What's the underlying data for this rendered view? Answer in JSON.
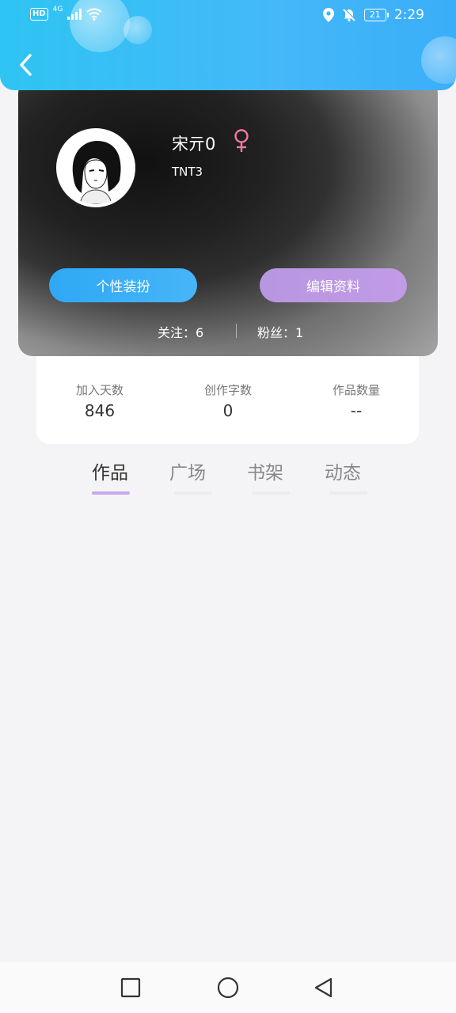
{
  "status_bar": {
    "hd": "HD",
    "network": "4G",
    "battery": "21",
    "time": "2:29"
  },
  "profile": {
    "username": "宋亓0",
    "user_id": "TNT3",
    "gender": "female",
    "dress_button": "个性装扮",
    "edit_button": "编辑资料",
    "following_label": "关注：6",
    "fans_label": "粉丝：1"
  },
  "stats": [
    {
      "label": "加入天数",
      "value": "846"
    },
    {
      "label": "创作字数",
      "value": "0"
    },
    {
      "label": "作品数量",
      "value": "--"
    }
  ],
  "tabs": [
    {
      "label": "作品",
      "active": true
    },
    {
      "label": "广场",
      "active": false
    },
    {
      "label": "书架",
      "active": false
    },
    {
      "label": "动态",
      "active": false
    }
  ],
  "colors": {
    "header": "#3ab8f6",
    "dress_button": "#3aaef7",
    "edit_button": "#bf9be5",
    "tab_indicator": "#c9a8ee",
    "gender_icon": "#f07aa0"
  }
}
